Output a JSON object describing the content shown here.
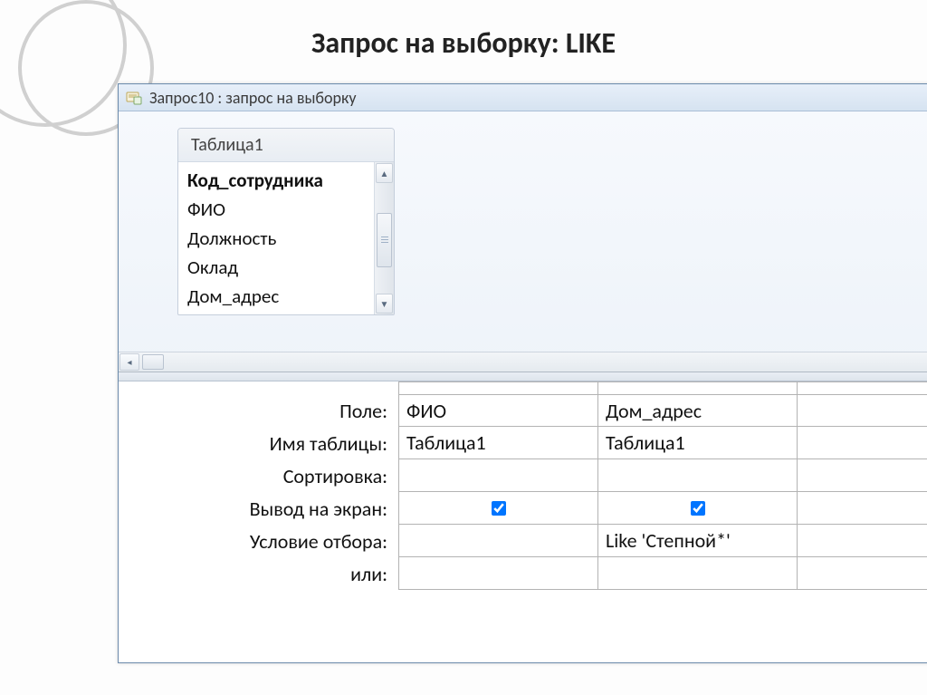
{
  "slide_title": "Запрос на выборку: LIKE",
  "window_title": "Запрос10 : запрос на выборку",
  "table_box": {
    "title": "Таблица1",
    "fields": [
      "Код_сотрудника",
      "ФИО",
      "Должность",
      "Оклад",
      "Дом_адрес"
    ],
    "pk_index": 0
  },
  "grid": {
    "row_labels": [
      "Поле:",
      "Имя таблицы:",
      "Сортировка:",
      "Вывод на экран:",
      "Условие отбора:",
      "или:"
    ],
    "columns": [
      {
        "field": "ФИО",
        "table": "Таблица1",
        "sort": "",
        "show": true,
        "criteria": "",
        "or": ""
      },
      {
        "field": "Дом_адрес",
        "table": "Таблица1",
        "sort": "",
        "show": true,
        "criteria": "Like 'Степной*'",
        "or": ""
      }
    ]
  }
}
